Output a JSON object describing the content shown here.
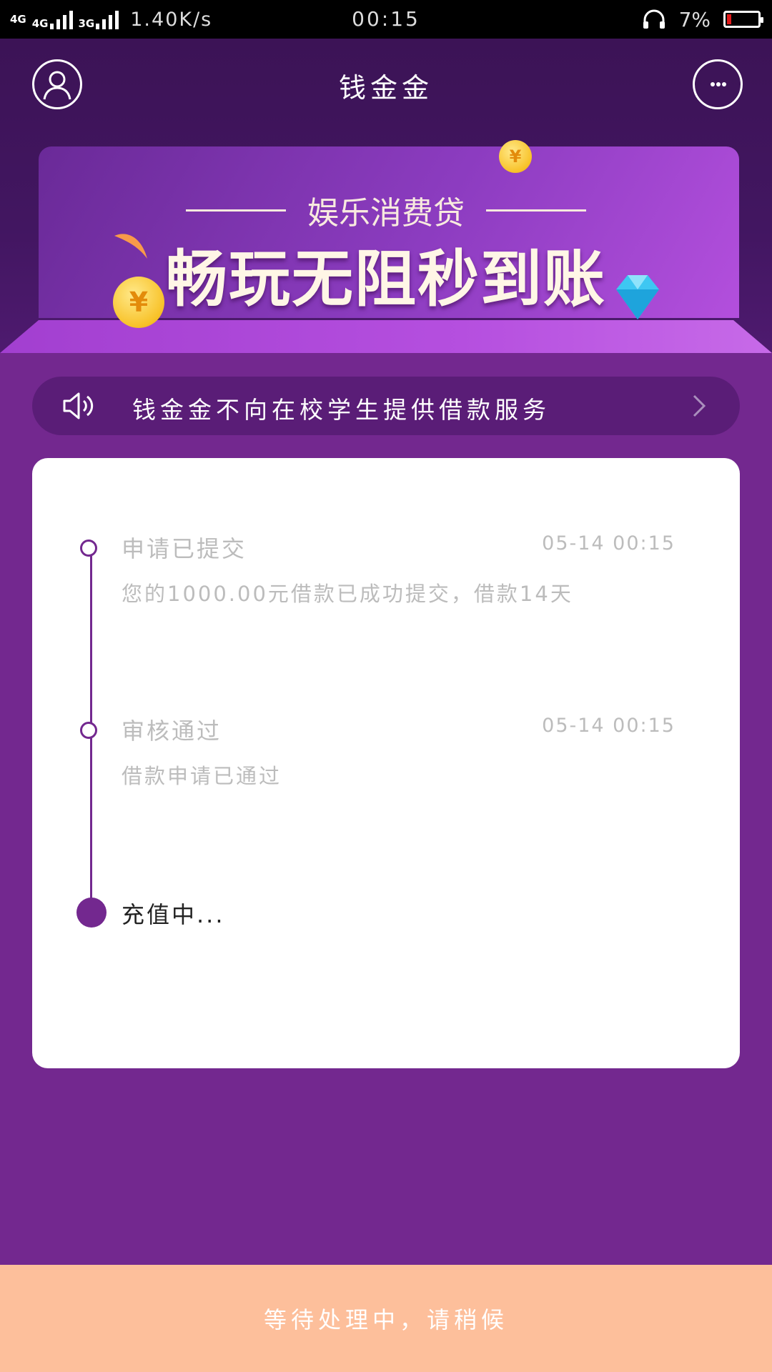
{
  "status_bar": {
    "net1": "4G",
    "net2": "4G",
    "net3": "3G",
    "speed": "1.40K/s",
    "time": "00:15",
    "battery": "7%"
  },
  "header": {
    "title": "钱金金"
  },
  "banner": {
    "subtitle": "娱乐消费贷",
    "headline": "畅玩无阻秒到账",
    "coin_symbol": "¥"
  },
  "notice": {
    "text": "钱金金不向在校学生提供借款服务"
  },
  "timeline": [
    {
      "title": "申请已提交",
      "time": "05-14 00:15",
      "desc": "您的1000.00元借款已成功提交，借款14天"
    },
    {
      "title": "审核通过",
      "time": "05-14 00:15",
      "desc": "借款申请已通过"
    },
    {
      "title": "充值中...",
      "time": "",
      "desc": ""
    }
  ],
  "footer": {
    "button_label": "等待处理中，请稍候"
  },
  "colors": {
    "primary": "#73288f",
    "header_bg": "#3c1356",
    "button_bg": "#fdbf9b"
  },
  "icons": {
    "profile": "user-icon",
    "message": "chat-icon",
    "notice": "speaker-icon",
    "arrow": "chevron-right-icon"
  }
}
